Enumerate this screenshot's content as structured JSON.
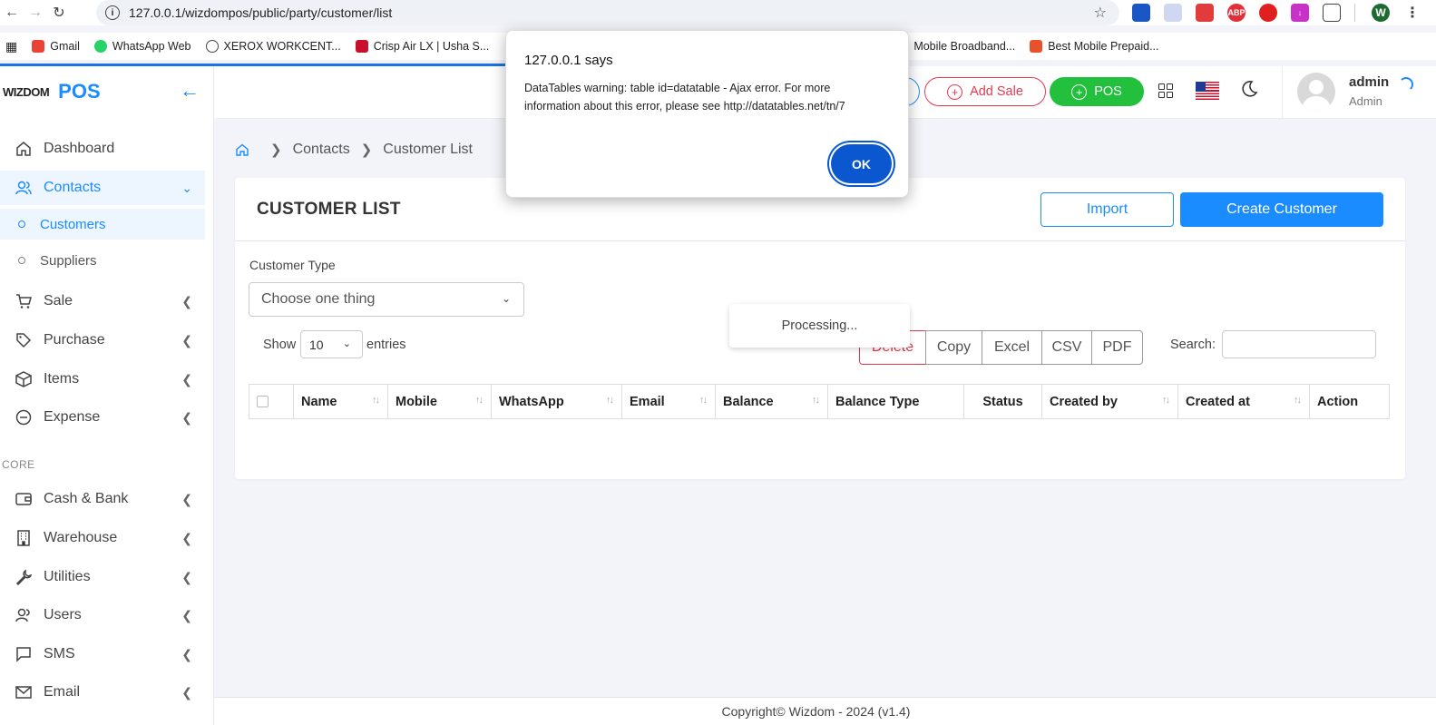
{
  "browser": {
    "url": "127.0.0.1/wizdompos/public/party/customer/list",
    "bookmarks": [
      "Gmail",
      "WhatsApp Web",
      "XEROX WORKCENT...",
      "Crisp Air LX | Usha S...",
      "Mobile Broadband...",
      "Best Mobile Prepaid..."
    ],
    "profile_initial": "W",
    "ext_abp": "ABP"
  },
  "brand": {
    "logo": "WIZDOM",
    "name": "POS"
  },
  "sidebar": {
    "items": [
      {
        "label": "Dashboard"
      },
      {
        "label": "Contacts"
      },
      {
        "label": "Customers"
      },
      {
        "label": "Suppliers"
      },
      {
        "label": "Sale"
      },
      {
        "label": "Purchase"
      },
      {
        "label": "Items"
      },
      {
        "label": "Expense"
      },
      {
        "label": "Cash & Bank"
      },
      {
        "label": "Warehouse"
      },
      {
        "label": "Utilities"
      },
      {
        "label": "Users"
      },
      {
        "label": "SMS"
      },
      {
        "label": "Email"
      }
    ],
    "section_core": "CORE"
  },
  "topbar": {
    "add_sale": "Add Sale",
    "pos": "POS",
    "user_name": "admin",
    "user_role": "Admin"
  },
  "breadcrumb": {
    "contacts": "Contacts",
    "current": "Customer List"
  },
  "card": {
    "title": "CUSTOMER LIST",
    "import": "Import",
    "create": "Create Customer",
    "customer_type_label": "Customer Type",
    "customer_type_placeholder": "Choose one thing",
    "show": "Show",
    "page_length": "10",
    "entries": "entries",
    "buttons": [
      "Delete",
      "Copy",
      "Excel",
      "CSV",
      "PDF"
    ],
    "search_label": "Search:",
    "processing": "Processing...",
    "columns": [
      "Name",
      "Mobile",
      "WhatsApp",
      "Email",
      "Balance",
      "Balance Type",
      "Status",
      "Created by",
      "Created at",
      "Action"
    ]
  },
  "footer": {
    "text": "Copyright© Wizdom - 2024 (v1.4)"
  },
  "dialog": {
    "title": "127.0.0.1 says",
    "message": "DataTables warning: table id=datatable - Ajax error. For more information about this error, please see http://datatables.net/tn/7",
    "ok": "OK"
  },
  "colors": {
    "accent": "#1a8cff",
    "danger": "#e53950",
    "success": "#22c03c",
    "dialog_button": "#0b57d0"
  }
}
